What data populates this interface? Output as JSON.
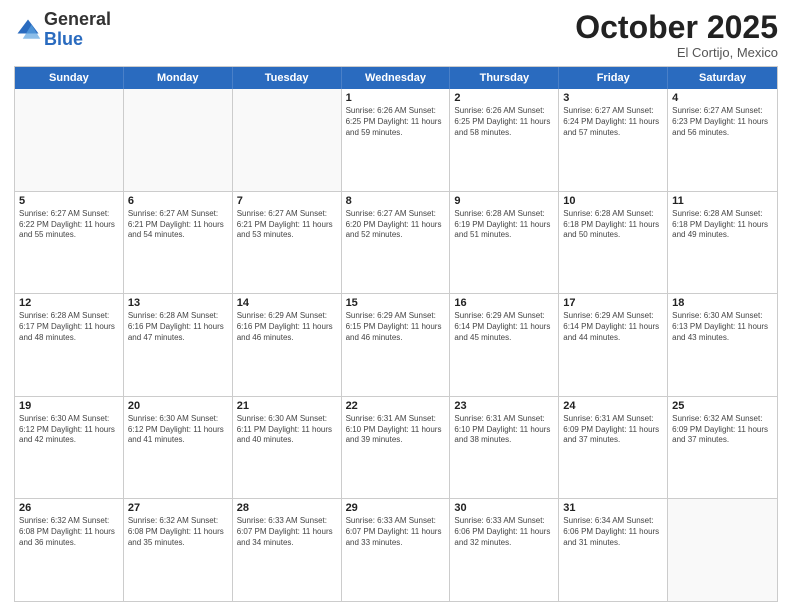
{
  "logo": {
    "general": "General",
    "blue": "Blue"
  },
  "title": "October 2025",
  "subtitle": "El Cortijo, Mexico",
  "header_days": [
    "Sunday",
    "Monday",
    "Tuesday",
    "Wednesday",
    "Thursday",
    "Friday",
    "Saturday"
  ],
  "weeks": [
    [
      {
        "day": "",
        "info": ""
      },
      {
        "day": "",
        "info": ""
      },
      {
        "day": "",
        "info": ""
      },
      {
        "day": "1",
        "info": "Sunrise: 6:26 AM\nSunset: 6:25 PM\nDaylight: 11 hours\nand 59 minutes."
      },
      {
        "day": "2",
        "info": "Sunrise: 6:26 AM\nSunset: 6:25 PM\nDaylight: 11 hours\nand 58 minutes."
      },
      {
        "day": "3",
        "info": "Sunrise: 6:27 AM\nSunset: 6:24 PM\nDaylight: 11 hours\nand 57 minutes."
      },
      {
        "day": "4",
        "info": "Sunrise: 6:27 AM\nSunset: 6:23 PM\nDaylight: 11 hours\nand 56 minutes."
      }
    ],
    [
      {
        "day": "5",
        "info": "Sunrise: 6:27 AM\nSunset: 6:22 PM\nDaylight: 11 hours\nand 55 minutes."
      },
      {
        "day": "6",
        "info": "Sunrise: 6:27 AM\nSunset: 6:21 PM\nDaylight: 11 hours\nand 54 minutes."
      },
      {
        "day": "7",
        "info": "Sunrise: 6:27 AM\nSunset: 6:21 PM\nDaylight: 11 hours\nand 53 minutes."
      },
      {
        "day": "8",
        "info": "Sunrise: 6:27 AM\nSunset: 6:20 PM\nDaylight: 11 hours\nand 52 minutes."
      },
      {
        "day": "9",
        "info": "Sunrise: 6:28 AM\nSunset: 6:19 PM\nDaylight: 11 hours\nand 51 minutes."
      },
      {
        "day": "10",
        "info": "Sunrise: 6:28 AM\nSunset: 6:18 PM\nDaylight: 11 hours\nand 50 minutes."
      },
      {
        "day": "11",
        "info": "Sunrise: 6:28 AM\nSunset: 6:18 PM\nDaylight: 11 hours\nand 49 minutes."
      }
    ],
    [
      {
        "day": "12",
        "info": "Sunrise: 6:28 AM\nSunset: 6:17 PM\nDaylight: 11 hours\nand 48 minutes."
      },
      {
        "day": "13",
        "info": "Sunrise: 6:28 AM\nSunset: 6:16 PM\nDaylight: 11 hours\nand 47 minutes."
      },
      {
        "day": "14",
        "info": "Sunrise: 6:29 AM\nSunset: 6:16 PM\nDaylight: 11 hours\nand 46 minutes."
      },
      {
        "day": "15",
        "info": "Sunrise: 6:29 AM\nSunset: 6:15 PM\nDaylight: 11 hours\nand 46 minutes."
      },
      {
        "day": "16",
        "info": "Sunrise: 6:29 AM\nSunset: 6:14 PM\nDaylight: 11 hours\nand 45 minutes."
      },
      {
        "day": "17",
        "info": "Sunrise: 6:29 AM\nSunset: 6:14 PM\nDaylight: 11 hours\nand 44 minutes."
      },
      {
        "day": "18",
        "info": "Sunrise: 6:30 AM\nSunset: 6:13 PM\nDaylight: 11 hours\nand 43 minutes."
      }
    ],
    [
      {
        "day": "19",
        "info": "Sunrise: 6:30 AM\nSunset: 6:12 PM\nDaylight: 11 hours\nand 42 minutes."
      },
      {
        "day": "20",
        "info": "Sunrise: 6:30 AM\nSunset: 6:12 PM\nDaylight: 11 hours\nand 41 minutes."
      },
      {
        "day": "21",
        "info": "Sunrise: 6:30 AM\nSunset: 6:11 PM\nDaylight: 11 hours\nand 40 minutes."
      },
      {
        "day": "22",
        "info": "Sunrise: 6:31 AM\nSunset: 6:10 PM\nDaylight: 11 hours\nand 39 minutes."
      },
      {
        "day": "23",
        "info": "Sunrise: 6:31 AM\nSunset: 6:10 PM\nDaylight: 11 hours\nand 38 minutes."
      },
      {
        "day": "24",
        "info": "Sunrise: 6:31 AM\nSunset: 6:09 PM\nDaylight: 11 hours\nand 37 minutes."
      },
      {
        "day": "25",
        "info": "Sunrise: 6:32 AM\nSunset: 6:09 PM\nDaylight: 11 hours\nand 37 minutes."
      }
    ],
    [
      {
        "day": "26",
        "info": "Sunrise: 6:32 AM\nSunset: 6:08 PM\nDaylight: 11 hours\nand 36 minutes."
      },
      {
        "day": "27",
        "info": "Sunrise: 6:32 AM\nSunset: 6:08 PM\nDaylight: 11 hours\nand 35 minutes."
      },
      {
        "day": "28",
        "info": "Sunrise: 6:33 AM\nSunset: 6:07 PM\nDaylight: 11 hours\nand 34 minutes."
      },
      {
        "day": "29",
        "info": "Sunrise: 6:33 AM\nSunset: 6:07 PM\nDaylight: 11 hours\nand 33 minutes."
      },
      {
        "day": "30",
        "info": "Sunrise: 6:33 AM\nSunset: 6:06 PM\nDaylight: 11 hours\nand 32 minutes."
      },
      {
        "day": "31",
        "info": "Sunrise: 6:34 AM\nSunset: 6:06 PM\nDaylight: 11 hours\nand 31 minutes."
      },
      {
        "day": "",
        "info": ""
      }
    ]
  ]
}
